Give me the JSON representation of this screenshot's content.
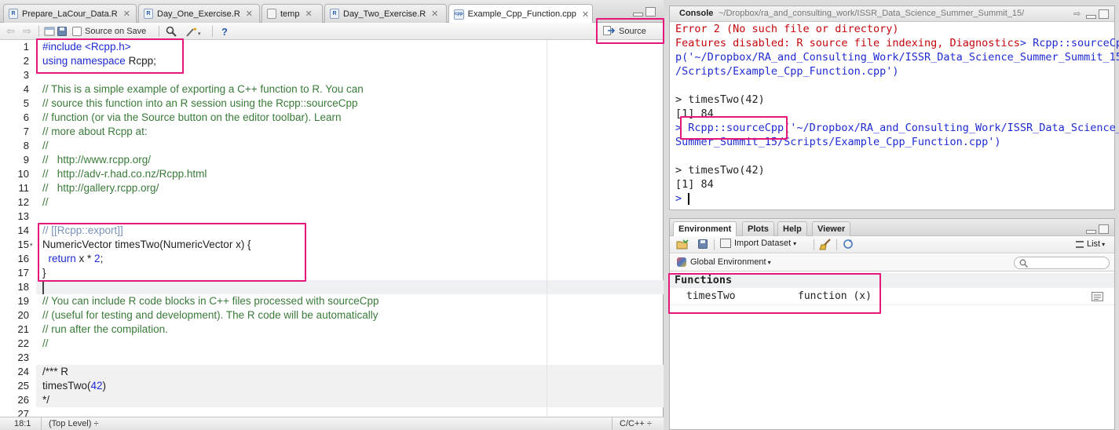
{
  "editor": {
    "tabs": [
      {
        "label": "Prepare_LaCour_Data.R",
        "icon": "r-file-icon"
      },
      {
        "label": "Day_One_Exercise.R",
        "icon": "r-file-icon"
      },
      {
        "label": "temp",
        "icon": "table-icon"
      },
      {
        "label": "Day_Two_Exercise.R",
        "icon": "r-file-icon"
      },
      {
        "label": "Example_Cpp_Function.cpp",
        "icon": "cpp-file-icon",
        "icon_text": "cpp"
      }
    ],
    "toolbar": {
      "source_on_save": "Source on Save",
      "source_button": "Source",
      "help": "?"
    },
    "line_numbers": [
      "1",
      "2",
      "3",
      "4",
      "5",
      "6",
      "7",
      "8",
      "9",
      "10",
      "11",
      "12",
      "13",
      "14",
      "15",
      "16",
      "17",
      "18",
      "19",
      "20",
      "21",
      "22",
      "23",
      "24",
      "25",
      "26",
      "27"
    ],
    "code": {
      "l1a": "#include ",
      "l1b": "<Rcpp.h>",
      "l2a": "using namespace ",
      "l2b": "Rcpp;",
      "l4": "// This is a simple example of exporting a C++ function to R. You can",
      "l5": "// source this function into an R session using the Rcpp::sourceCpp",
      "l6": "// function (or via the Source button on the editor toolbar). Learn",
      "l7": "// more about Rcpp at:",
      "l8": "//",
      "l9": "//   http://www.rcpp.org/",
      "l10": "//   http://adv-r.had.co.nz/Rcpp.html",
      "l11": "//   http://gallery.rcpp.org/",
      "l12": "//",
      "l14": "// [[Rcpp::export]]",
      "l15": "NumericVector timesTwo(NumericVector x) {",
      "l16a": "  return ",
      "l16b": "x * ",
      "l16c": "2",
      "l16d": ";",
      "l17": "}",
      "l19": "// You can include R code blocks in C++ files processed with sourceCpp",
      "l20": "// (useful for testing and development). The R code will be automatically",
      "l21": "// run after the compilation.",
      "l22": "//",
      "l24": "/*** R",
      "l25a": "timesTwo(",
      "l25b": "42",
      "l25c": ")",
      "l26": "*/"
    },
    "status": {
      "position": "18:1",
      "scope": "(Top Level) ÷",
      "filetype": "C/C++ ÷"
    }
  },
  "console": {
    "title": "Console",
    "path": "~/Dropbox/ra_and_consulting_work/ISSR_Data_Science_Summer_Summit_15/",
    "lines": [
      {
        "text": "Error 2 (No such file or directory)",
        "kind": "err"
      },
      {
        "text": "Features disabled: R source file indexing, Diagnostics",
        "kind": "err",
        "tail": "> Rcpp::sourceCp"
      },
      {
        "text": "p('~/Dropbox/RA_and_Consulting_Work/ISSR_Data_Science_Summer_Summit_15",
        "kind": "cmd"
      },
      {
        "text": "/Scripts/Example_Cpp_Function.cpp')",
        "kind": "cmd"
      },
      {
        "text": "",
        "kind": "out"
      },
      {
        "text": "> timesTwo(42)",
        "kind": "out"
      },
      {
        "text": "[1] 84",
        "kind": "out"
      },
      {
        "text": "> Rcpp::sourceCpp('~/Dropbox/RA_and_Consulting_Work/ISSR_Data_Science_",
        "kind": "cmd"
      },
      {
        "text": "Summer_Summit_15/Scripts/Example_Cpp_Function.cpp')",
        "kind": "cmd"
      },
      {
        "text": "",
        "kind": "out"
      },
      {
        "text": "> timesTwo(42)",
        "kind": "out"
      },
      {
        "text": "[1] 84",
        "kind": "out"
      },
      {
        "text": "> ",
        "kind": "cmd"
      }
    ]
  },
  "environment": {
    "tabs": [
      "Environment",
      "Plots",
      "Help",
      "Viewer"
    ],
    "import_dataset": "Import Dataset",
    "view_mode": "List",
    "scope": "Global Environment",
    "section": "Functions",
    "rows": [
      {
        "name": "timesTwo",
        "value": "function (x)"
      }
    ]
  }
}
